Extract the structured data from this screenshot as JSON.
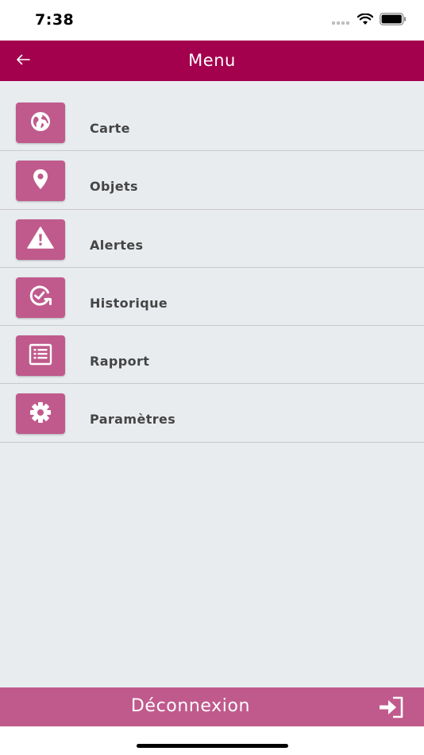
{
  "status_bar": {
    "time": "7:38"
  },
  "header": {
    "title": "Menu",
    "back_icon": "arrow-left-icon"
  },
  "menu": {
    "items": [
      {
        "label": "Carte",
        "icon": "globe-icon"
      },
      {
        "label": "Objets",
        "icon": "map-pin-icon"
      },
      {
        "label": "Alertes",
        "icon": "warning-icon"
      },
      {
        "label": "Historique",
        "icon": "history-icon"
      },
      {
        "label": "Rapport",
        "icon": "report-list-icon"
      },
      {
        "label": "Paramètres",
        "icon": "gear-icon"
      }
    ]
  },
  "footer": {
    "logout_label": "Déconnexion",
    "logout_icon": "sign-in-icon"
  },
  "colors": {
    "header_bg": "#a3004d",
    "accent": "#c05a8c",
    "content_bg": "#e9ecef"
  }
}
